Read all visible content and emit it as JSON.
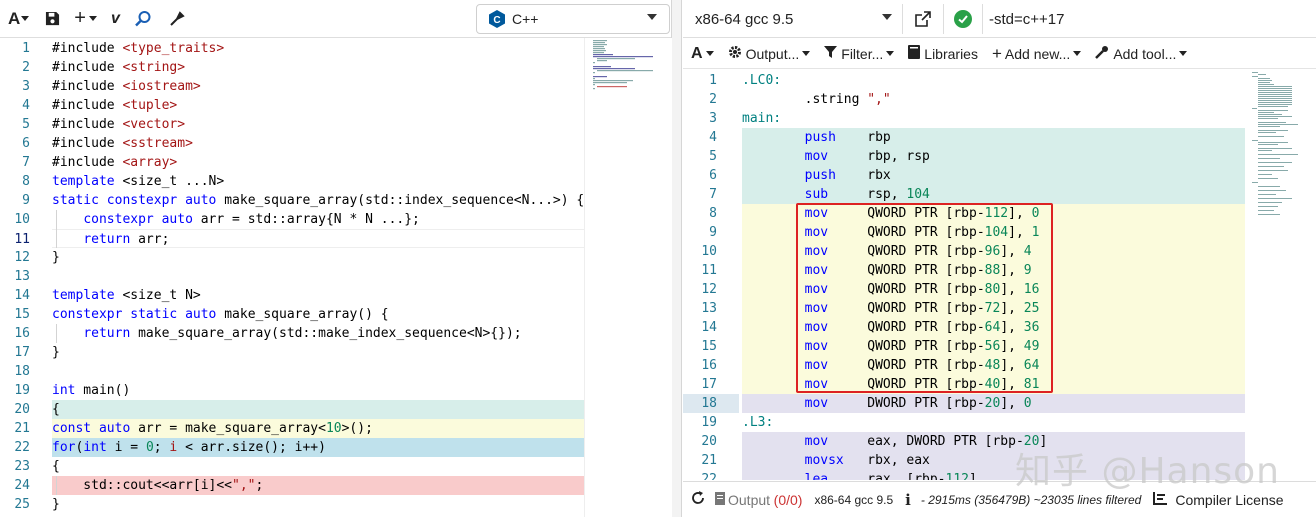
{
  "editor": {
    "language": "C++",
    "lines": [
      {
        "n": "1",
        "html": "#include <span class='str'>&lt;type_traits&gt;</span>"
      },
      {
        "n": "2",
        "html": "#include <span class='str'>&lt;string&gt;</span>"
      },
      {
        "n": "3",
        "html": "#include <span class='str'>&lt;iostream&gt;</span>"
      },
      {
        "n": "4",
        "html": "#include <span class='str'>&lt;tuple&gt;</span>"
      },
      {
        "n": "5",
        "html": "#include <span class='str'>&lt;vector&gt;</span>"
      },
      {
        "n": "6",
        "html": "#include <span class='str'>&lt;sstream&gt;</span>"
      },
      {
        "n": "7",
        "html": "#include <span class='str'>&lt;array&gt;</span>"
      },
      {
        "n": "8",
        "html": "<span class='kw'>template</span> &lt;size_t ...N&gt;"
      },
      {
        "n": "9",
        "html": "<span class='kw'>static</span> <span class='kw'>constexpr</span> <span class='kw'>auto</span> make_square_array(std::index_sequence&lt;N...&gt;) {"
      },
      {
        "n": "10",
        "html": "    <span class='kw'>constexpr</span> <span class='kw'>auto</span> arr = std::array{N * N ...};"
      },
      {
        "n": "11",
        "html": "    <span class='kw'>return</span> arr;"
      },
      {
        "n": "12",
        "html": "}"
      },
      {
        "n": "13",
        "html": ""
      },
      {
        "n": "14",
        "html": "<span class='kw'>template</span> &lt;size_t N&gt;"
      },
      {
        "n": "15",
        "html": "<span class='kw'>constexpr</span> <span class='kw'>static</span> <span class='kw'>auto</span> make_square_array() {"
      },
      {
        "n": "16",
        "html": "    <span class='kw'>return</span> make_square_array(std::make_index_sequence&lt;N&gt;{});"
      },
      {
        "n": "17",
        "html": "}"
      },
      {
        "n": "18",
        "html": ""
      },
      {
        "n": "19",
        "html": "<span class='kw'>int</span> main()"
      },
      {
        "n": "20",
        "html": "{"
      },
      {
        "n": "21",
        "html": "<span class='kw'>const</span> <span class='kw'>auto</span> arr = make_square_array&lt;<span class='num'>10</span>&gt;();"
      },
      {
        "n": "22",
        "html": "<span class='kw'>for</span>(<span class='kw'>int</span> i = <span class='num'>0</span>; <span class='str'>i</span> &lt; arr.size(); i++)"
      },
      {
        "n": "23",
        "html": "{"
      },
      {
        "n": "24",
        "html": "    std::cout&lt;&lt;arr[i]&lt;&lt;<span class='str'>\",\"</span>;"
      },
      {
        "n": "25",
        "html": "}"
      }
    ],
    "line_backgrounds": {
      "20": "#d7eeea",
      "21": "#fbfbdc",
      "22": "#bfe1ec",
      "23": "#ffffff",
      "24": "#f9cbcb",
      "25": "#ffffff"
    },
    "active_line": "11"
  },
  "compiler": {
    "name": "x86-64 gcc 9.5",
    "options": "-std=c++17",
    "toolbar": {
      "output_label": "Output...",
      "filter_label": "Filter...",
      "libraries_label": "Libraries",
      "add_new_label": "Add new...",
      "add_tool_label": "Add tool..."
    },
    "asm_lines": [
      {
        "n": "1",
        "html": "<span class='lbl'>.LC0:</span>",
        "bg": "#ffffff"
      },
      {
        "n": "2",
        "html": "        .string <span class='str'>\",\"</span>",
        "bg": "#ffffff"
      },
      {
        "n": "3",
        "html": "<span class='lbl'>main:</span>",
        "bg": "#ffffff"
      },
      {
        "n": "4",
        "html": "        <span class='ins'>push</span>    rbp",
        "bg": "#d7eeea"
      },
      {
        "n": "5",
        "html": "        <span class='ins'>mov</span>     rbp, rsp",
        "bg": "#d7eeea"
      },
      {
        "n": "6",
        "html": "        <span class='ins'>push</span>    rbx",
        "bg": "#d7eeea"
      },
      {
        "n": "7",
        "html": "        <span class='ins'>sub</span>     rsp, <span class='num'>104</span>",
        "bg": "#d7eeea"
      },
      {
        "n": "8",
        "html": "        <span class='ins'>mov</span>     QWORD PTR [rbp-<span class='num'>112</span>], <span class='num'>0</span>",
        "bg": "#fbfbdc"
      },
      {
        "n": "9",
        "html": "        <span class='ins'>mov</span>     QWORD PTR [rbp-<span class='num'>104</span>], <span class='num'>1</span>",
        "bg": "#fbfbdc"
      },
      {
        "n": "10",
        "html": "        <span class='ins'>mov</span>     QWORD PTR [rbp-<span class='num'>96</span>], <span class='num'>4</span>",
        "bg": "#fbfbdc"
      },
      {
        "n": "11",
        "html": "        <span class='ins'>mov</span>     QWORD PTR [rbp-<span class='num'>88</span>], <span class='num'>9</span>",
        "bg": "#fbfbdc"
      },
      {
        "n": "12",
        "html": "        <span class='ins'>mov</span>     QWORD PTR [rbp-<span class='num'>80</span>], <span class='num'>16</span>",
        "bg": "#fbfbdc"
      },
      {
        "n": "13",
        "html": "        <span class='ins'>mov</span>     QWORD PTR [rbp-<span class='num'>72</span>], <span class='num'>25</span>",
        "bg": "#fbfbdc"
      },
      {
        "n": "14",
        "html": "        <span class='ins'>mov</span>     QWORD PTR [rbp-<span class='num'>64</span>], <span class='num'>36</span>",
        "bg": "#fbfbdc"
      },
      {
        "n": "15",
        "html": "        <span class='ins'>mov</span>     QWORD PTR [rbp-<span class='num'>56</span>], <span class='num'>49</span>",
        "bg": "#fbfbdc"
      },
      {
        "n": "16",
        "html": "        <span class='ins'>mov</span>     QWORD PTR [rbp-<span class='num'>48</span>], <span class='num'>64</span>",
        "bg": "#fbfbdc"
      },
      {
        "n": "17",
        "html": "        <span class='ins'>mov</span>     QWORD PTR [rbp-<span class='num'>40</span>], <span class='num'>81</span>",
        "bg": "#fbfbdc"
      },
      {
        "n": "18",
        "html": "        <span class='ins'>mov</span>     DWORD PTR [rbp-<span class='num'>20</span>], <span class='num'>0</span>",
        "bg": "#e3e1ef"
      },
      {
        "n": "19",
        "html": "<span class='lbl'>.L3:</span>",
        "bg": "#ffffff"
      },
      {
        "n": "20",
        "html": "        <span class='ins'>mov</span>     eax, DWORD PTR [rbp-<span class='num'>20</span>]",
        "bg": "#e3e1ef"
      },
      {
        "n": "21",
        "html": "        <span class='ins'>movsx</span>   rbx, eax",
        "bg": "#e3e1ef"
      },
      {
        "n": "22",
        "html": "        <span class='ins'>lea</span>     rax, [rbp-<span class='num'>112</span>]",
        "bg": "#e3e1ef"
      }
    ],
    "status": {
      "output_label": "Output",
      "output_count": "(0/0)",
      "compiler_name": "x86-64 gcc 9.5",
      "stats": "- 2915ms (356479B) ~23035 lines filtered",
      "license_label": "Compiler License"
    }
  },
  "watermark": "知乎 @Hanson",
  "colors": {
    "highlight_box": "#d22222",
    "line_number": "#237893"
  }
}
